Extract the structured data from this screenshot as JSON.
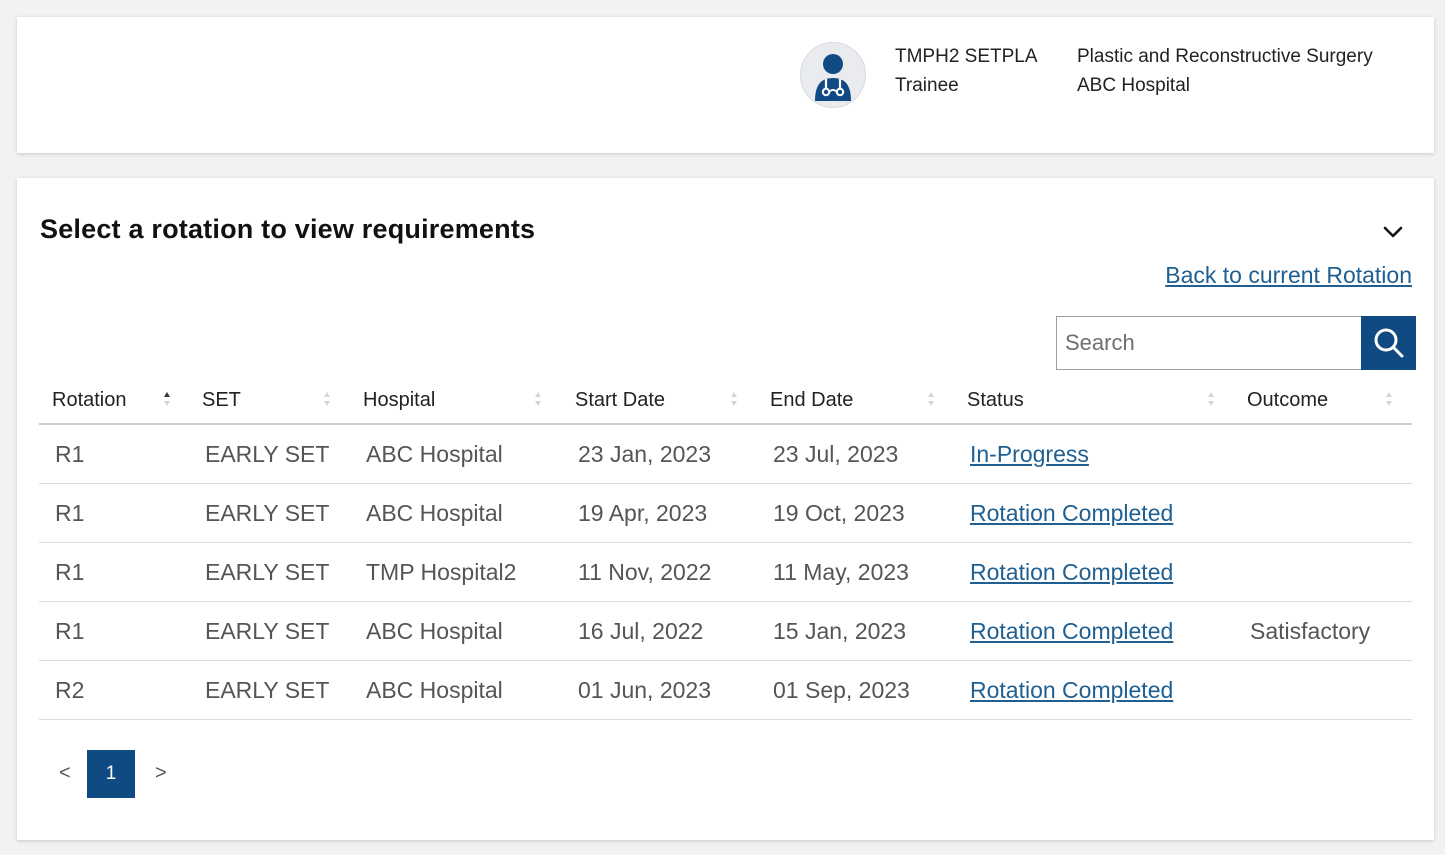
{
  "header": {
    "user_name": "TMPH2 SETPLA",
    "user_role": "Trainee",
    "department": "Plastic and Reconstructive Surgery",
    "hospital": "ABC Hospital",
    "avatar_icon": "doctor-avatar-icon",
    "avatar_color": "#0f4a82"
  },
  "rotations": {
    "title": "Select a rotation to view requirements",
    "collapse_icon": "chevron-down-icon",
    "back_link": "Back to current Rotation",
    "search": {
      "placeholder": "Search",
      "value": "",
      "button_icon": "search-icon"
    },
    "columns": [
      "Rotation",
      "SET",
      "Hospital",
      "Start Date",
      "End Date",
      "Status",
      "Outcome"
    ],
    "sorted_column": "Rotation",
    "sort_direction": "ascending",
    "rows": [
      {
        "rotation": "R1",
        "set": "EARLY SET",
        "hospital": "ABC Hospital",
        "start": "23 Jan, 2023",
        "end": "23 Jul, 2023",
        "status": "In-Progress",
        "outcome": ""
      },
      {
        "rotation": "R1",
        "set": "EARLY SET",
        "hospital": "ABC Hospital",
        "start": "19 Apr, 2023",
        "end": "19 Oct, 2023",
        "status": "Rotation Completed",
        "outcome": ""
      },
      {
        "rotation": "R1",
        "set": "EARLY SET",
        "hospital": "TMP Hospital2",
        "start": "11 Nov, 2022",
        "end": "11 May, 2023",
        "status": "Rotation Completed",
        "outcome": ""
      },
      {
        "rotation": "R1",
        "set": "EARLY SET",
        "hospital": "ABC Hospital",
        "start": "16 Jul, 2022",
        "end": "15 Jan, 2023",
        "status": "Rotation Completed",
        "outcome": "Satisfactory"
      },
      {
        "rotation": "R2",
        "set": "EARLY SET",
        "hospital": "ABC Hospital",
        "start": "01 Jun, 2023",
        "end": "01 Sep, 2023",
        "status": "Rotation Completed",
        "outcome": ""
      }
    ],
    "pagination": {
      "prev": "<",
      "current_page": "1",
      "next": ">"
    }
  },
  "colors": {
    "primary": "#0f4a82",
    "link": "#1f5f91"
  }
}
